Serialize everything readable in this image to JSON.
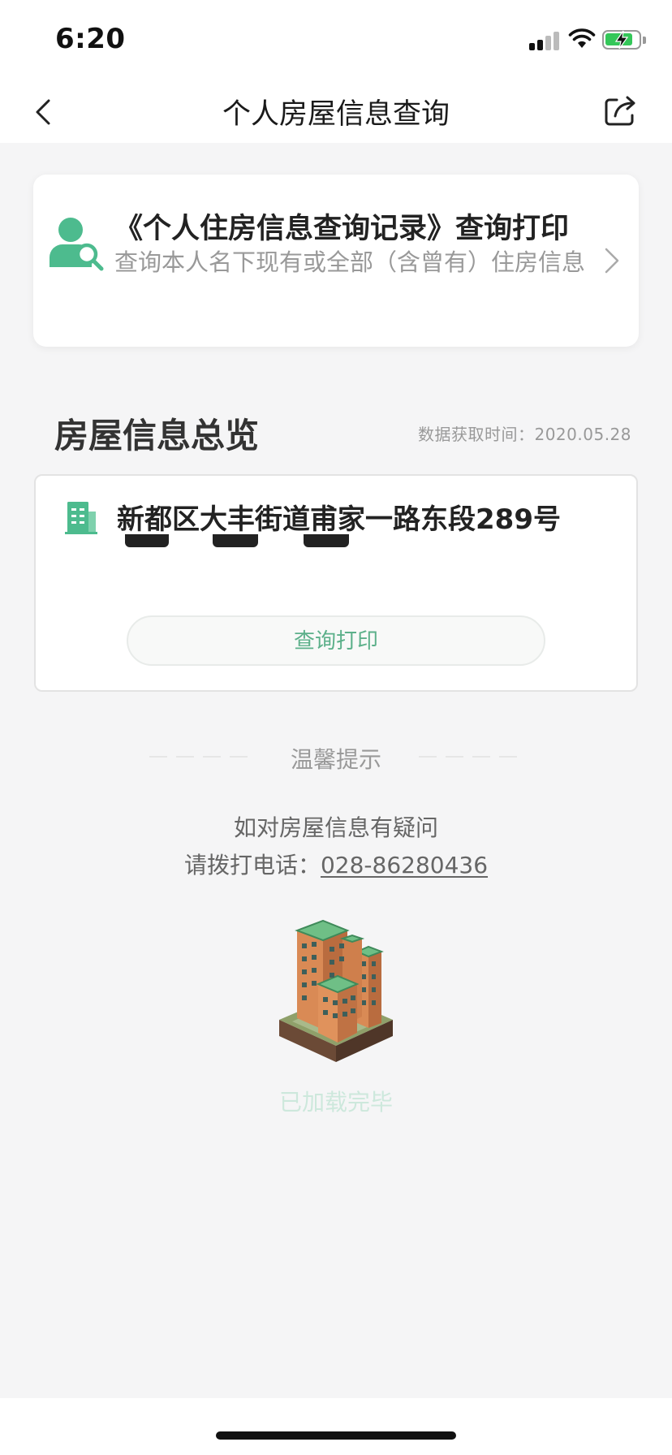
{
  "status_bar": {
    "time": "6:20"
  },
  "nav": {
    "title": "个人房屋信息查询"
  },
  "record_card": {
    "title": "《个人住房信息查询记录》查询打印",
    "subtitle": "查询本人名下现有或全部（含曾有）住房信息"
  },
  "overview": {
    "title": "房屋信息总览",
    "fetch_time": "数据获取时间：2020.05.28"
  },
  "house": {
    "address": "新都区大丰街道甫家一路东段289号",
    "query_button": "查询打印"
  },
  "tips": {
    "label": "温馨提示",
    "line1": "如对房屋信息有疑问",
    "phone_prefix": "请拨打电话：",
    "phone": "028-86280436"
  },
  "footer": {
    "loaded_text": "已加载完毕"
  },
  "colors": {
    "accent": "#4dbb8e",
    "button_text": "#5cb08a",
    "battery": "#34c759",
    "loaded_text": "#cde8dc"
  },
  "icons": {
    "back": "chevron-left-icon",
    "share": "share-icon",
    "user_search": "user-search-icon",
    "chevron": "chevron-right-icon",
    "building": "building-icon"
  },
  "battery_level": 0.85
}
